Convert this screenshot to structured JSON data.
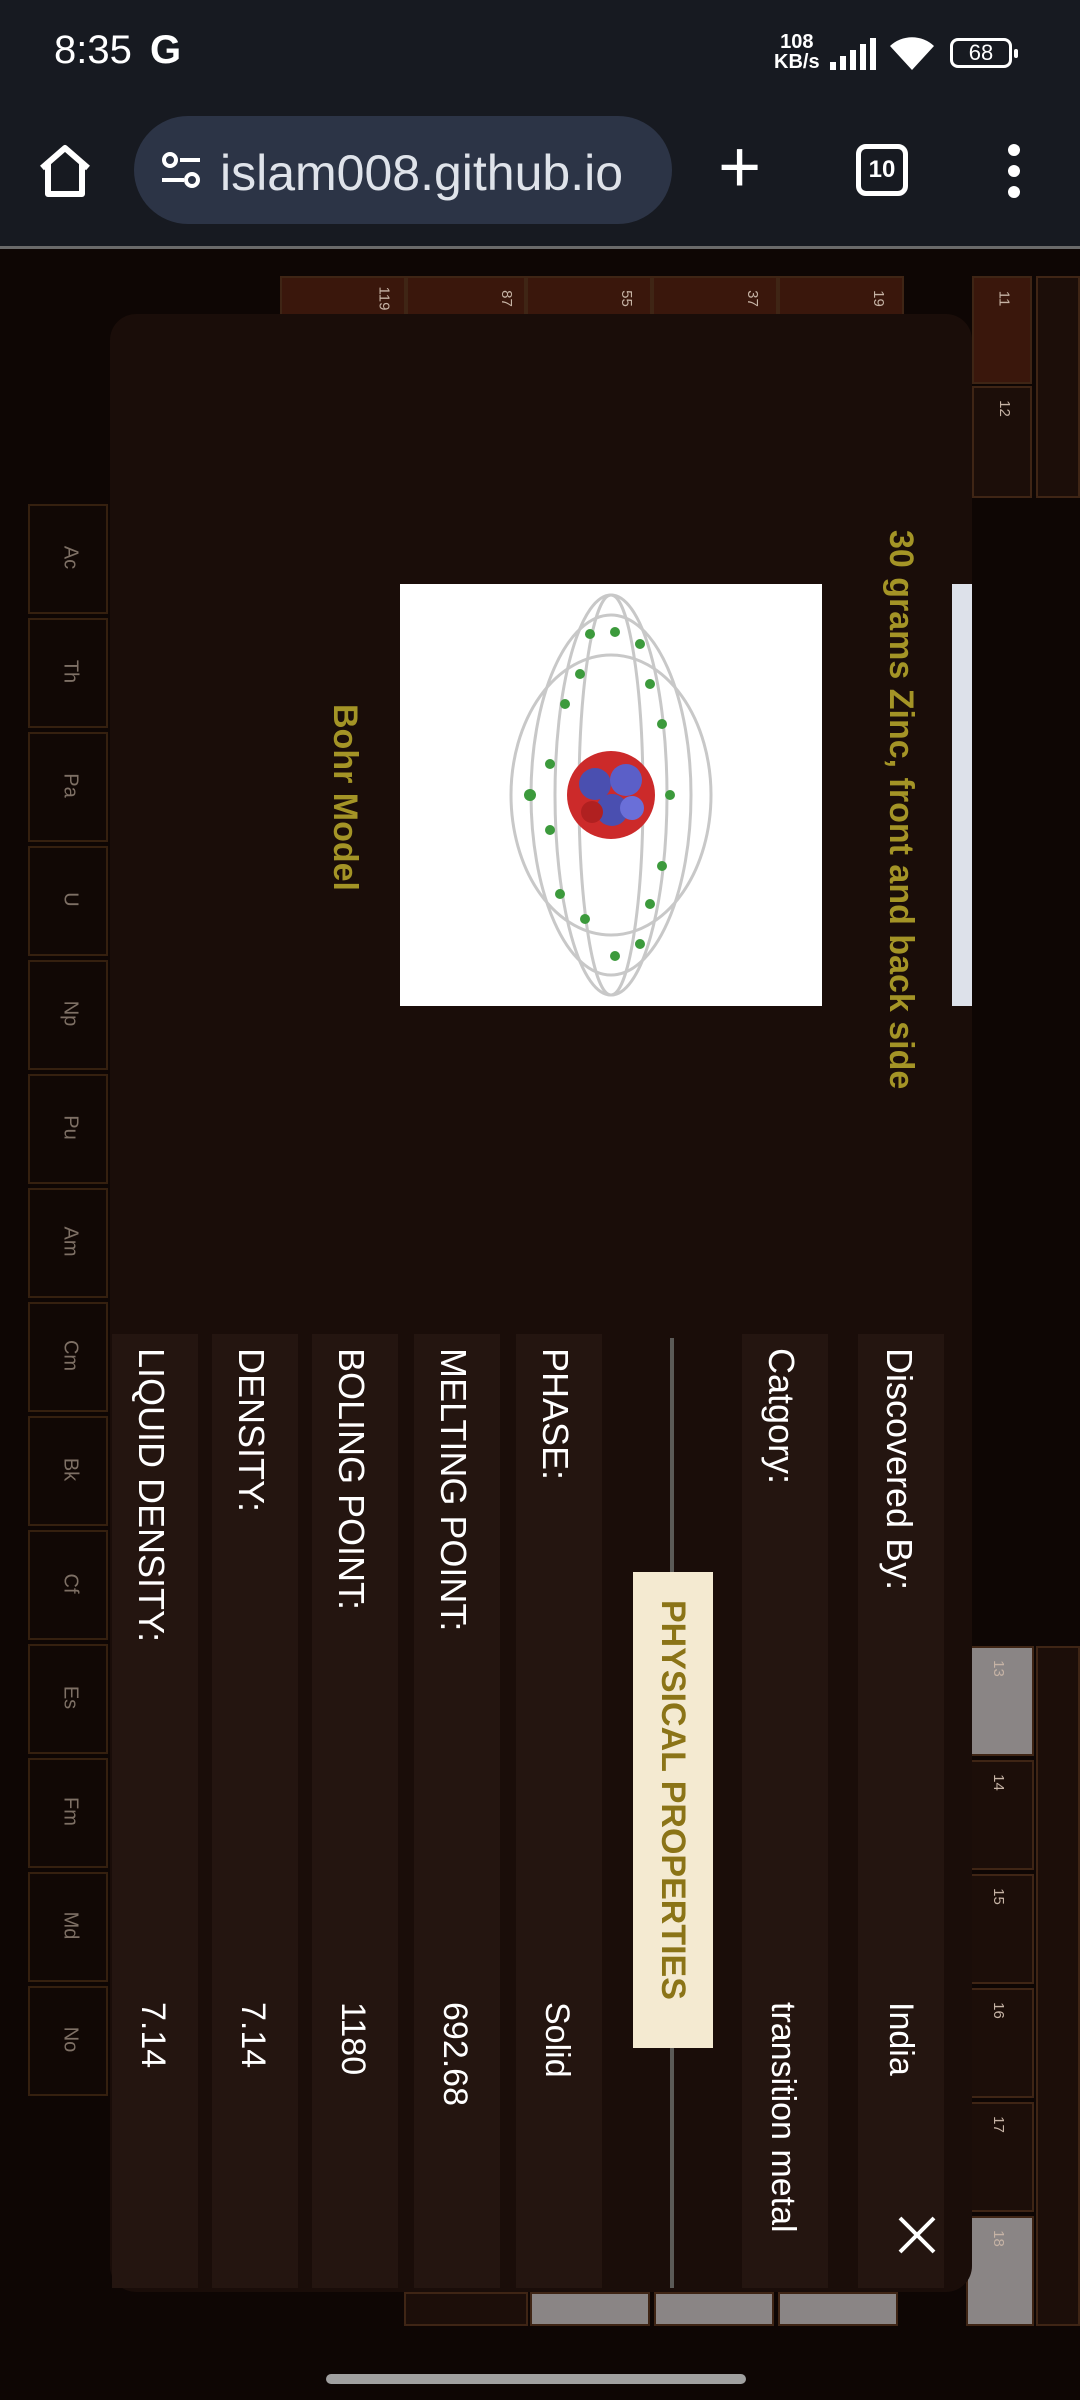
{
  "status_bar": {
    "time": "8:35",
    "google_icon": "G",
    "net_speed_value": "108",
    "net_speed_unit": "KB/s",
    "battery": "68"
  },
  "browser": {
    "url": "islam008.github.io",
    "new_tab": "+",
    "tab_count": "10"
  },
  "background_table": {
    "left_numbers": [
      "119",
      "87",
      "55",
      "37",
      "19",
      "11"
    ],
    "right_numbers_top": [
      "12"
    ],
    "right_numbers_bottom": [
      "13",
      "14",
      "15",
      "16",
      "17",
      "18"
    ],
    "f_block": [
      "Ac",
      "Th",
      "Pa",
      "U",
      "Np",
      "Pu",
      "Am",
      "Cm",
      "Bk",
      "Cf",
      "Es",
      "Fm",
      "Md",
      "No"
    ]
  },
  "modal": {
    "image_caption": "30 grams Zinc, front and back side",
    "bohr_caption": "Bohr Model",
    "discovered_by_label": "Discovered By:",
    "discovered_by_value": "India",
    "category_label": "Catgory:",
    "category_value": "transition metal",
    "section_title": "PHYSICAL PROPERTIES",
    "phase_label": "PHASE:",
    "phase_value": "Solid",
    "melting_label": "MELTING POINT:",
    "melting_value": "692.68",
    "boiling_label": "BOLING POINT:",
    "boiling_value": "1180",
    "density_label": "DENSITY:",
    "density_value": "7.14",
    "liquid_density_label": "LIQUID DENSITY:",
    "liquid_density_value": "7.14"
  },
  "colors": {
    "caption": "#a49426",
    "modal_bg": "#1a0d09",
    "badge_bg": "#f4ead1"
  },
  "icons": [
    "home-icon",
    "site-info-icon",
    "tab-switcher-icon",
    "menu-icon",
    "close-icon",
    "signal-icon",
    "wifi-icon",
    "battery-icon"
  ]
}
